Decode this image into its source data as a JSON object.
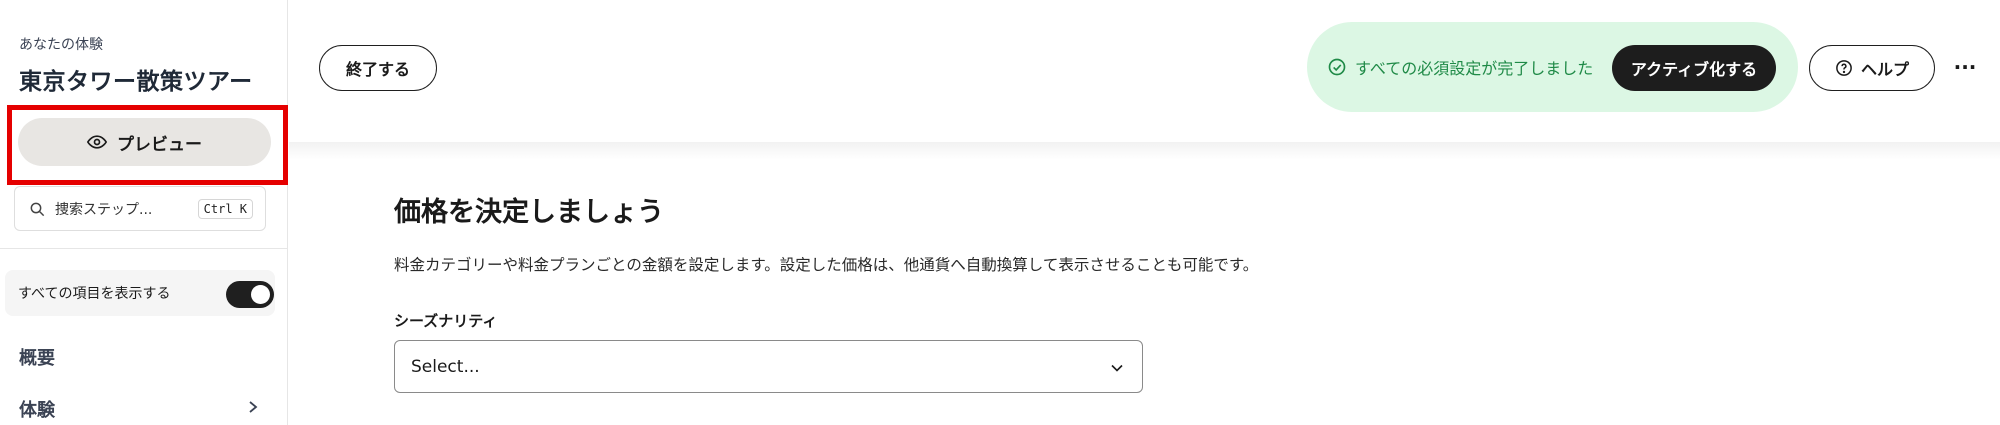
{
  "sidebar": {
    "experience_label": "あなたの体験",
    "experience_title": "東京タワー散策ツアー",
    "preview_label": "プレビュー",
    "search_placeholder": "捜索ステップ...",
    "search_shortcut": "Ctrl K",
    "show_all_label": "すべての項目を表示する",
    "show_all_enabled": true,
    "nav_items": [
      {
        "label": "概要",
        "icon": ""
      },
      {
        "label": "体験",
        "icon": "chevron-right-icon"
      }
    ]
  },
  "header": {
    "end_label": "終了する",
    "status_text": "すべての必須設定が完了しました",
    "status_icon": "check-circle-icon",
    "activate_label": "アクティブ化する",
    "help_label": "ヘルプ",
    "help_icon": "question-circle-icon",
    "more_label": "···"
  },
  "main": {
    "title": "価格を決定しましょう",
    "description": "料金カテゴリーや料金プランごとの金額を設定します。設定した価格は、他通貨へ自動換算して表示させることも可能です。",
    "seasonality_label": "シーズナリティ",
    "seasonality_value": "Select..."
  },
  "colors": {
    "highlight": "#e50000",
    "status_bg": "#dcf7e4",
    "status_text": "#1f8a47",
    "primary_button": "#1d1d1d"
  }
}
